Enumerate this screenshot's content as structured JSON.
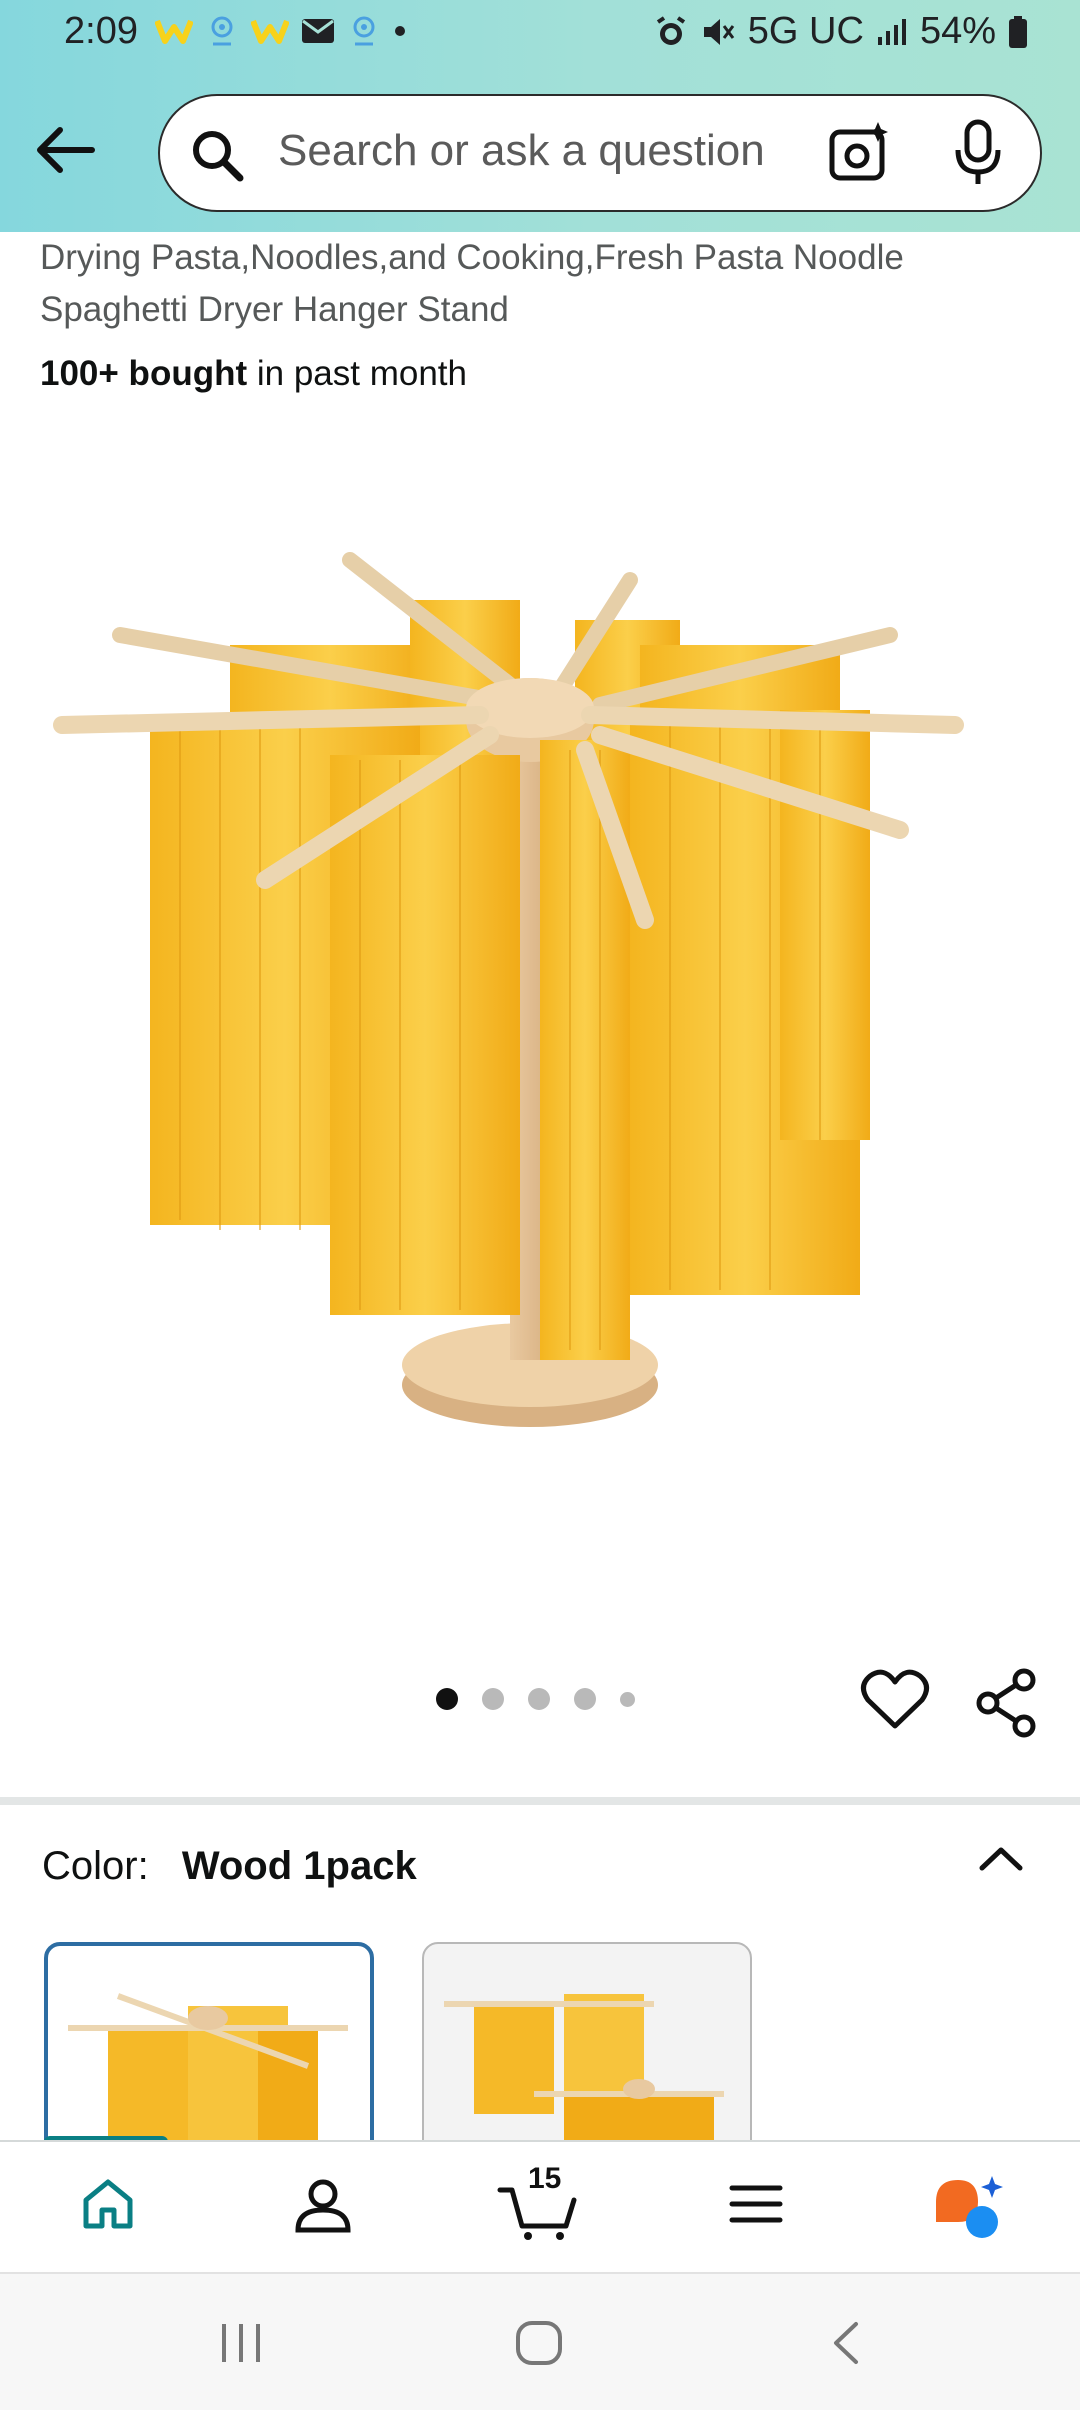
{
  "status_bar": {
    "time": "2:09",
    "network": "5G UC",
    "battery": "54%"
  },
  "search": {
    "placeholder": "Search or ask a question"
  },
  "product": {
    "title": "Drying Pasta,Noodles,and Cooking,Fresh Pasta Noodle Spaghetti Dryer Hanger Stand",
    "bought_bold": "100+ bought",
    "bought_rest": " in past month",
    "image_count": 5,
    "active_image": 1
  },
  "variation": {
    "label": "Color:",
    "value": "Wood 1pack"
  },
  "bottom_nav": {
    "cart_count": "15",
    "items": [
      "home-icon",
      "account-icon",
      "cart-icon",
      "menu-icon",
      "ai-assistant-icon"
    ]
  },
  "colors": {
    "header_gradient_start": "#85d7dd",
    "header_gradient_end": "#a9e3d3",
    "selected_border": "#2d6da3",
    "accent_teal": "#0a7f84",
    "pasta": "#f5b928"
  }
}
